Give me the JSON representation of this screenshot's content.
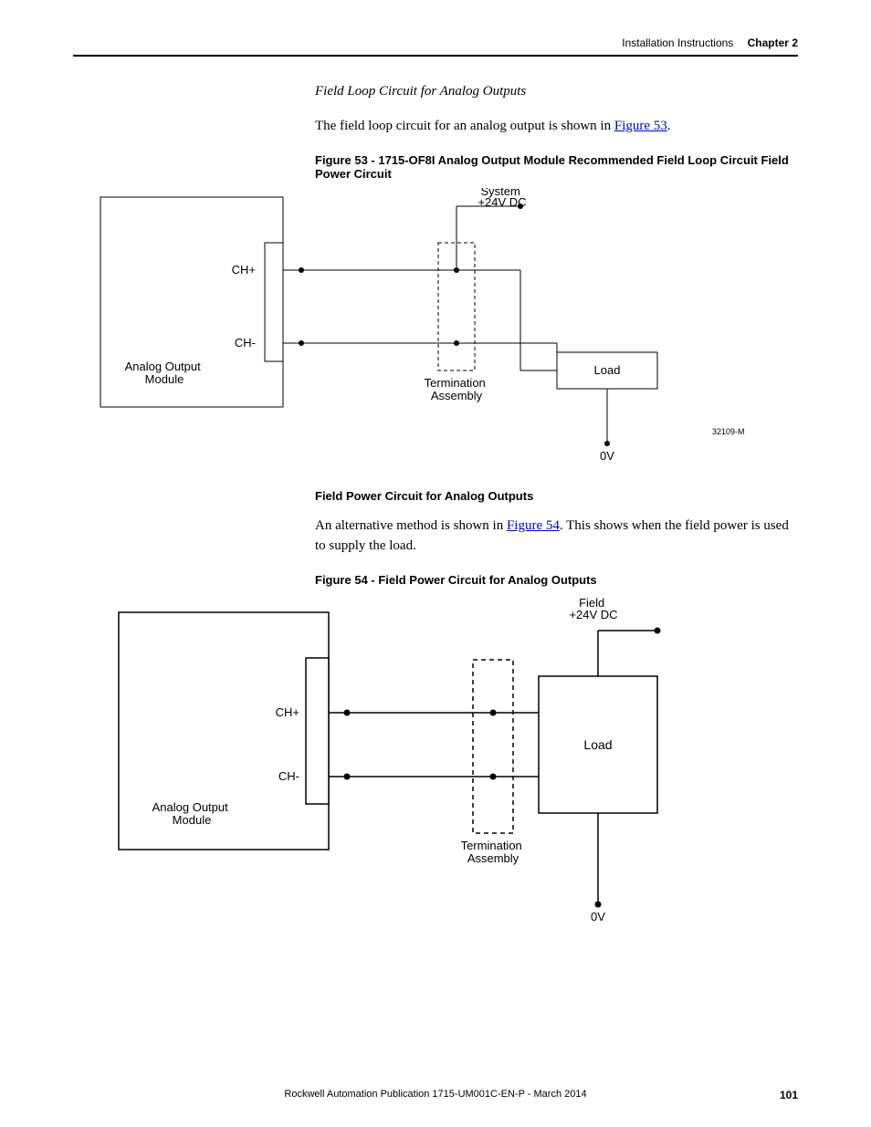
{
  "header": {
    "section": "Installation Instructions",
    "chapter": "Chapter 2"
  },
  "s1": {
    "title": "Field Loop Circuit for Analog Outputs",
    "body_pre": "The field loop circuit for an analog output is shown in ",
    "body_link": "Figure 53",
    "body_post": ".",
    "fig_caption": "Figure 53 - 1715-OF8I Analog Output Module Recommended Field Loop Circuit Field Power Circuit"
  },
  "diag1": {
    "module": "Analog Output\nModule",
    "chp": "CH+",
    "chm": "CH-",
    "term": "Termination\nAssembly",
    "load": "Load",
    "vtop": "System\n+24V DC",
    "vbot": "0V",
    "code": "32109-M"
  },
  "s2": {
    "title": "Field Power Circuit for Analog Outputs",
    "body_pre": "An alternative method is shown in ",
    "body_link": "Figure 54",
    "body_post": ". This shows when the field power is used to supply the load.",
    "fig_caption": "Figure 54 - Field Power Circuit for Analog Outputs"
  },
  "diag2": {
    "module": "Analog Output\nModule",
    "chp": "CH+",
    "chm": "CH-",
    "term": "Termination\nAssembly",
    "load": "Load",
    "vtop": "Field\n+24V DC",
    "vbot": "0V"
  },
  "footer": {
    "pub": "Rockwell Automation Publication 1715-UM001C-EN-P - March 2014",
    "page": "101"
  }
}
